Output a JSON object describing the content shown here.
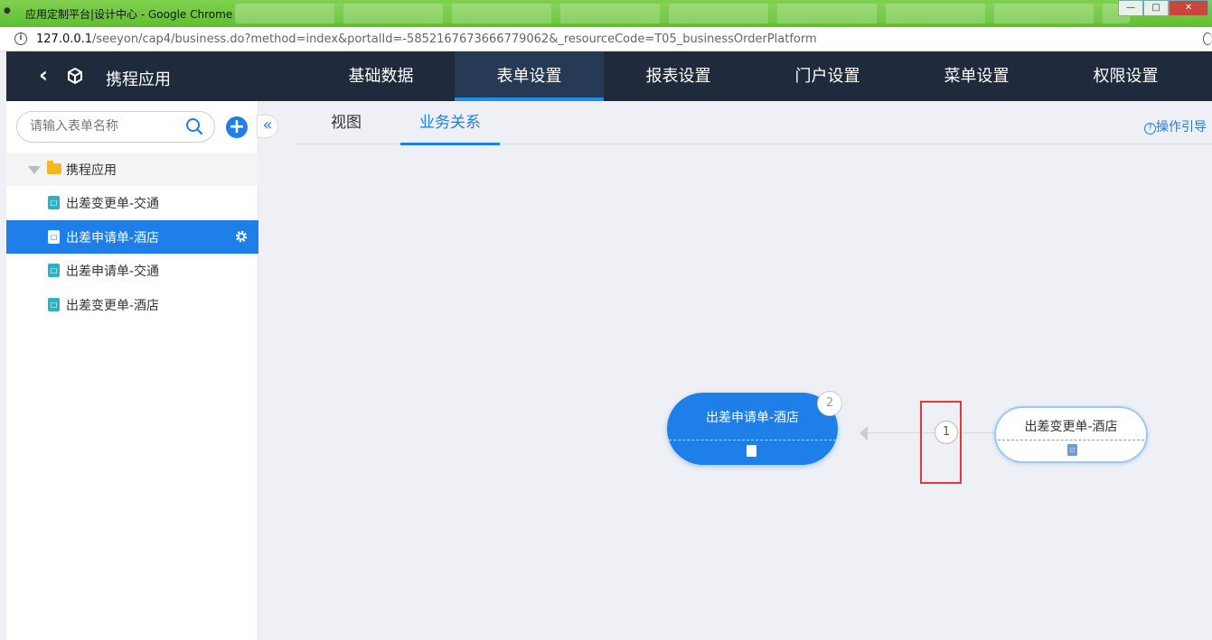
{
  "browser": {
    "window_title": "应用定制平台|设计中心 - Google Chrome",
    "url_host": "127.0.0.1",
    "url_path": "/seeyon/cap4/business.do?method=index&portalId=-5852167673666779062&_resourceCode=T05_businessOrderPlatform"
  },
  "header": {
    "app_name": "携程应用",
    "nav": [
      {
        "label": "基础数据"
      },
      {
        "label": "表单设置"
      },
      {
        "label": "报表设置"
      },
      {
        "label": "门户设置"
      },
      {
        "label": "菜单设置"
      },
      {
        "label": "权限设置"
      }
    ],
    "active_nav": "表单设置"
  },
  "sidebar": {
    "search_placeholder": "请输入表单名称",
    "add_label": "+",
    "root_label": "携程应用",
    "items": [
      {
        "label": "出差变更单-交通"
      },
      {
        "label": "出差申请单-酒店"
      },
      {
        "label": "出差申请单-交通"
      },
      {
        "label": "出差变更单-酒店"
      }
    ],
    "selected": "出差申请单-酒店"
  },
  "main": {
    "tabs": [
      {
        "label": "视图"
      },
      {
        "label": "业务关系"
      }
    ],
    "active_tab": "业务关系",
    "guide_label": "操作引导"
  },
  "diagram": {
    "main_node": {
      "label": "出差申请单-酒店",
      "badge": "2"
    },
    "edge_label": "1",
    "side_node": {
      "label": "出差变更单-酒店"
    }
  },
  "colors": {
    "accent": "#1e7fe8",
    "header_bg": "#1f2b3c",
    "highlight": "#e53935"
  }
}
